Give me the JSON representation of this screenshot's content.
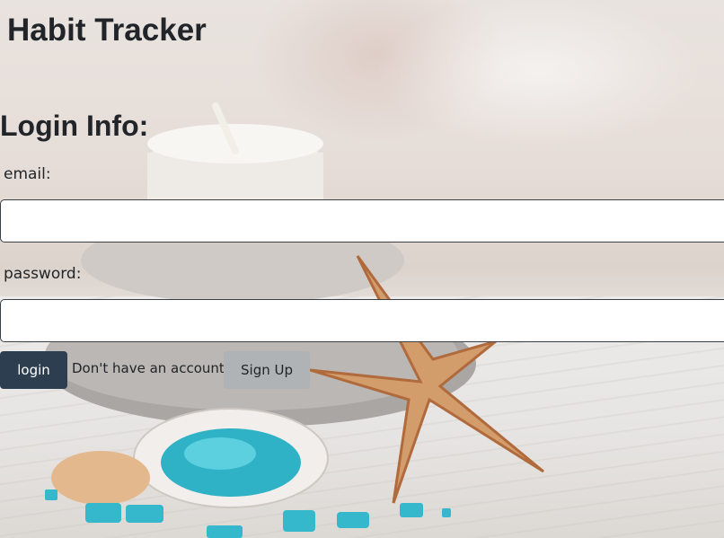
{
  "app": {
    "title": "Habit Tracker"
  },
  "login": {
    "heading": "Login Info:",
    "email_label": "email:",
    "email_value": "",
    "password_label": "password:",
    "password_value": "",
    "login_button": "login",
    "no_account_text": "Don't have an account?",
    "signup_button": "Sign Up"
  },
  "colors": {
    "login_button_bg": "#2c3e50",
    "signup_button_bg": "#b0b3b5",
    "text": "#212529"
  }
}
